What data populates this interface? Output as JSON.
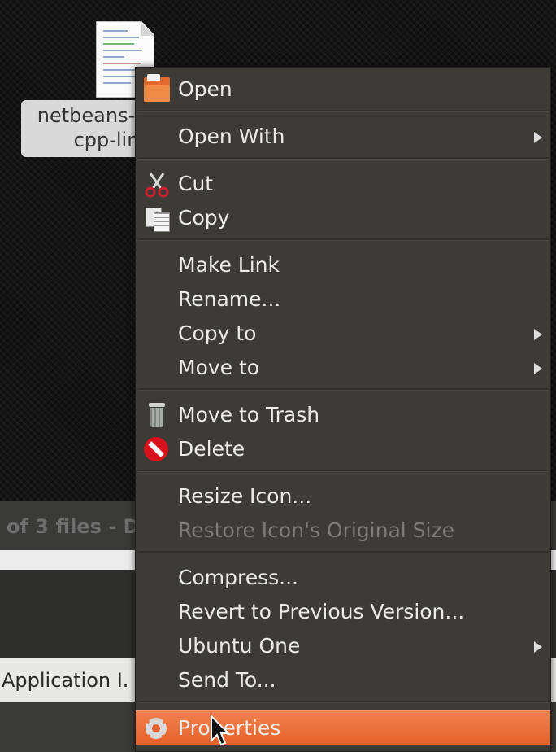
{
  "desktop": {
    "file_label_line1": "netbeans-",
    "file_label_line2": "cpp-lin"
  },
  "background": {
    "status_text": "of 3 files - D",
    "app_bar_text": "Application I."
  },
  "menu": {
    "open": "Open",
    "open_with": "Open With",
    "cut": "Cut",
    "copy": "Copy",
    "make_link": "Make Link",
    "rename": "Rename...",
    "copy_to": "Copy to",
    "move_to": "Move to",
    "move_to_trash": "Move to Trash",
    "delete": "Delete",
    "resize_icon": "Resize Icon...",
    "restore_icon_size": "Restore Icon's Original Size",
    "compress": "Compress...",
    "revert_version": "Revert to Previous Version...",
    "ubuntu_one": "Ubuntu One",
    "send_to": "Send To...",
    "properties": "Properties"
  },
  "icons": {
    "open": "folder-open-icon",
    "cut": "scissors-icon",
    "copy": "copy-icon",
    "trash": "trash-icon",
    "delete": "delete-icon",
    "properties": "gear-icon"
  },
  "colors": {
    "menu_bg": "#3c3b37",
    "highlight": "#e5622b",
    "text": "#ecebe8",
    "disabled_text": "#7d7c78"
  }
}
